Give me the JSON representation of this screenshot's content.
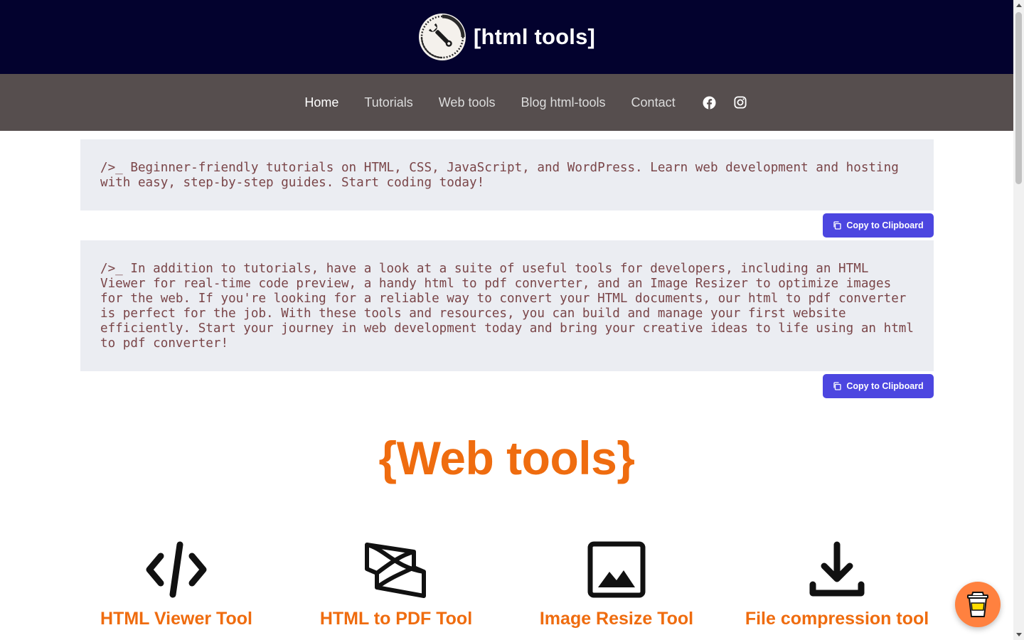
{
  "header": {
    "brand_text": "[html tools]",
    "logo_icon": "wrench-gauge-logo-icon",
    "background": "#03022e"
  },
  "nav": {
    "background": "#564e4e",
    "items": [
      {
        "label": "Home",
        "active": true
      },
      {
        "label": "Tutorials",
        "active": false
      },
      {
        "label": "Web tools",
        "active": false
      },
      {
        "label": "Blog html-tools",
        "active": false
      },
      {
        "label": "Contact",
        "active": false
      }
    ],
    "social": [
      "facebook-icon",
      "instagram-icon"
    ]
  },
  "code_blocks": [
    {
      "text": "/>_ Beginner-friendly tutorials on HTML, CSS, JavaScript, and WordPress. Learn web development and hosting with easy, step-by-step guides. Start coding today!",
      "copy_label": "Copy to Clipboard"
    },
    {
      "text": "/>_ In addition to tutorials, have a look at a suite of useful tools for developers, including an HTML Viewer for real-time code preview, a handy html to pdf converter, and an Image Resizer to optimize images for the web. If you're looking for a reliable way to convert your HTML documents, our html to pdf converter is perfect for the job. With these tools and resources, you can build and manage your first website efficiently. Start your journey in web development today and bring your creative ideas to life using an html to pdf converter!",
      "copy_label": "Copy to Clipboard"
    }
  ],
  "section": {
    "title": "{Web tools}",
    "accent_color": "#ef6c0f"
  },
  "tools": [
    {
      "label": "HTML Viewer Tool",
      "icon": "code-brackets-icon"
    },
    {
      "label": "HTML to PDF Tool",
      "icon": "pdf-convert-icon"
    },
    {
      "label": "Image Resize Tool",
      "icon": "image-icon"
    },
    {
      "label": "File compression tool",
      "icon": "download-icon"
    }
  ],
  "floating": {
    "icon": "coffee-cup-icon",
    "color": "#ff813f"
  },
  "copy_button_color": "#4c46e0"
}
